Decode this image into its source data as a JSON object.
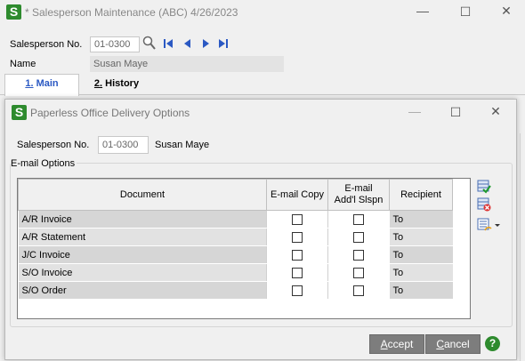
{
  "outer_window": {
    "title": "* Salesperson Maintenance (ABC) 4/26/2023",
    "app_icon_letter": "S",
    "salesperson_no_label": "Salesperson No.",
    "salesperson_no_value": "01-0300",
    "name_label": "Name",
    "name_value": "Susan Maye",
    "tabs": [
      {
        "num": "1.",
        "label": " Main"
      },
      {
        "num": "2.",
        "label": " History"
      }
    ]
  },
  "dialog": {
    "title": "Paperless Office Delivery Options",
    "app_icon_letter": "S",
    "salesperson_no_label": "Salesperson No.",
    "salesperson_no_value": "01-0300",
    "salesperson_name": "Susan Maye",
    "group_label": "E-mail Options",
    "columns": {
      "document": "Document",
      "email_copy": "E-mail Copy",
      "email_addl_1": "E-mail",
      "email_addl_2": "Add'l Slspn",
      "recipient": "Recipient"
    },
    "rows": [
      {
        "document": "A/R Invoice",
        "email_copy": false,
        "email_addl": false,
        "recipient": "To"
      },
      {
        "document": "A/R Statement",
        "email_copy": false,
        "email_addl": false,
        "recipient": "To"
      },
      {
        "document": "J/C Invoice",
        "email_copy": false,
        "email_addl": false,
        "recipient": "To"
      },
      {
        "document": "S/O Invoice",
        "email_copy": false,
        "email_addl": false,
        "recipient": "To"
      },
      {
        "document": "S/O Order",
        "email_copy": false,
        "email_addl": false,
        "recipient": "To"
      }
    ],
    "accept_label": "Accept",
    "cancel_label": "Cancel",
    "help_glyph": "?"
  },
  "colors": {
    "app_icon_green": "#2e8b2e",
    "button_gray": "#7d7d7d",
    "nav_blue": "#2b59c3"
  }
}
